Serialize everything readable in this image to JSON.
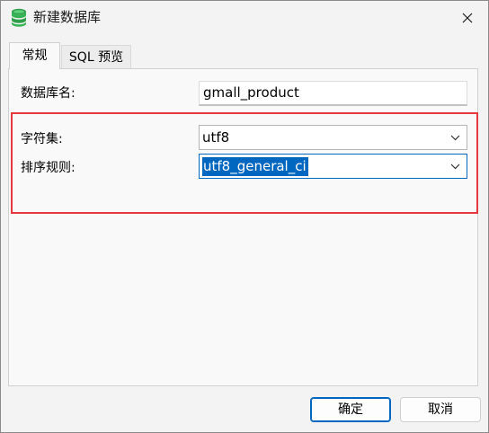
{
  "window": {
    "title": "新建数据库",
    "icon": "database-icon",
    "close_icon": "close-icon"
  },
  "tabs": [
    {
      "label": "常规",
      "active": true
    },
    {
      "label": "SQL 预览",
      "active": false
    }
  ],
  "form": {
    "db_name_label": "数据库名:",
    "db_name_value": "gmall_product",
    "charset_label": "字符集:",
    "charset_value": "utf8",
    "collation_label": "排序规则:",
    "collation_value": "utf8_general_ci"
  },
  "buttons": {
    "ok_label": "确定",
    "cancel_label": "取消"
  },
  "colors": {
    "accent": "#0067c0",
    "highlight_box": "#e5393f",
    "db_icon_green": "#2e9e4a"
  }
}
